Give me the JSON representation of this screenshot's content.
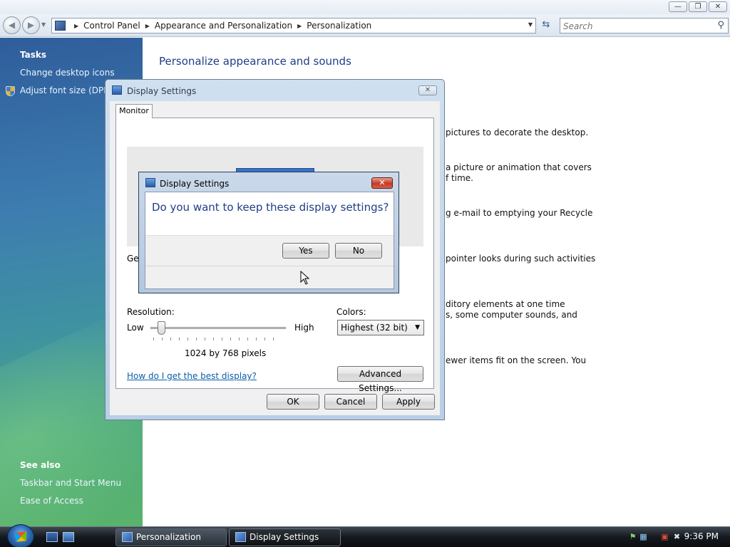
{
  "window": {
    "caption_buttons": [
      "minimize",
      "restore",
      "close"
    ]
  },
  "address_bar": {
    "crumbs": [
      "Control Panel",
      "Appearance and Personalization",
      "Personalization"
    ],
    "search_placeholder": "Search"
  },
  "task_pane": {
    "tasks_heading": "Tasks",
    "tasks": [
      "Change desktop icons",
      "Adjust font size (DPI)"
    ],
    "see_also_heading": "See also",
    "see_also": [
      "Taskbar and Start Menu",
      "Ease of Access"
    ]
  },
  "main": {
    "title": "Personalize appearance and sounds",
    "snippets": [
      "pictures to decorate the desktop.",
      "a picture or animation that covers",
      "f time.",
      "g e-mail to emptying your Recycle",
      "pointer looks during such activities",
      "ditory elements at one time",
      "s, some computer sounds, and",
      "ewer items fit on the screen. You"
    ]
  },
  "display_settings": {
    "title": "Display Settings",
    "tab": "Monitor",
    "gen_fragment": "Ger",
    "resolution_label": "Resolution:",
    "low_label": "Low",
    "high_label": "High",
    "resolution_value": "1024 by 768 pixels",
    "resolution_slider_level": 0,
    "colors_label": "Colors:",
    "colors_value": "Highest (32 bit)",
    "help_link": "How do I get the best display?",
    "advanced_button": "Advanced Settings...",
    "ok_button": "OK",
    "cancel_button": "Cancel",
    "apply_button": "Apply"
  },
  "confirm_dialog": {
    "title": "Display Settings",
    "question": "Do you want to keep these display settings?",
    "yes_button": "Yes",
    "no_button": "No",
    "close_glyph": "✕"
  },
  "taskbar": {
    "buttons": [
      "Personalization",
      "Display Settings"
    ],
    "clock": "9:36 PM"
  }
}
